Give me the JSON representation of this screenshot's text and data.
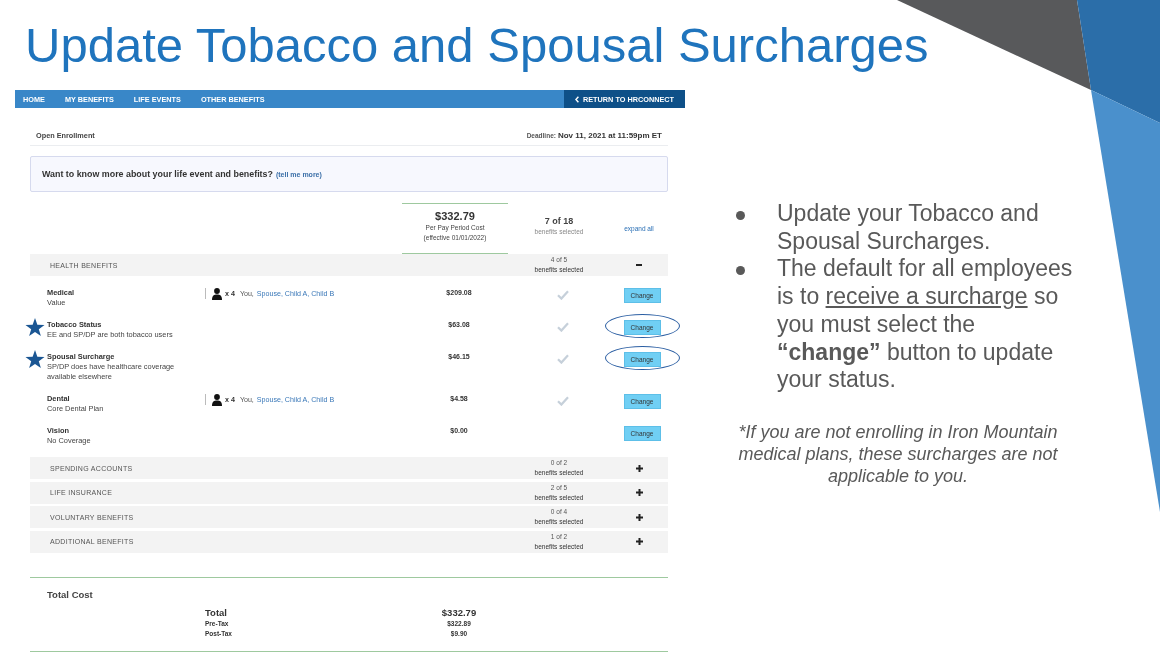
{
  "slide": {
    "title": "Update Tobacco and Spousal Surcharges"
  },
  "portal": {
    "nav": {
      "items": [
        "HOME",
        "MY BENEFITS",
        "LIFE EVENTS",
        "OTHER BENEFITS"
      ],
      "return_link": "RETURN TO HRCONNECT"
    },
    "page_title": "Open Enrollment",
    "deadline": {
      "label": "Deadline:",
      "value": "Nov 11, 2021 at 11:59pm ET"
    },
    "info_banner": {
      "text": "Want to know more about your life event and benefits?",
      "link": "(tell me more)"
    },
    "summary": {
      "cost": "$332.79",
      "cost_label": "Per Pay Period Cost",
      "effective": "(effective 01/01/2022)",
      "count": "7 of 18",
      "count_label": "benefits selected",
      "expand_link": "expand all"
    },
    "sections": [
      {
        "title": "HEALTH BENEFITS",
        "count": "4 of 5",
        "count_label": "benefits selected",
        "expanded": true,
        "plans": [
          {
            "name": "Medical",
            "detail": "Value",
            "covered": {
              "count": "x 4",
              "self": "You,",
              "others": "Spouse, Child A, Child B"
            },
            "price": "$209.08",
            "checked": true,
            "button": "Change",
            "starred": false,
            "circled": false
          },
          {
            "name": "Tobacco Status",
            "detail": "EE and SP/DP are both tobacco users",
            "price": "$63.08",
            "checked": true,
            "button": "Change",
            "starred": true,
            "circled": true
          },
          {
            "name": "Spousal Surcharge",
            "detail": "SP/DP does have healthcare coverage available elsewhere",
            "price": "$46.15",
            "checked": true,
            "button": "Change",
            "starred": true,
            "circled": true
          },
          {
            "name": "Dental",
            "detail": "Core Dental Plan",
            "covered": {
              "count": "x 4",
              "self": "You,",
              "others": "Spouse, Child A, Child B"
            },
            "price": "$4.58",
            "checked": true,
            "button": "Change",
            "starred": false,
            "circled": false
          },
          {
            "name": "Vision",
            "detail": "No Coverage",
            "price": "$0.00",
            "checked": false,
            "button": "Change",
            "starred": false,
            "circled": false
          }
        ]
      },
      {
        "title": "SPENDING ACCOUNTS",
        "count": "0 of 2",
        "count_label": "benefits selected",
        "expanded": false
      },
      {
        "title": "LIFE INSURANCE",
        "count": "2 of 5",
        "count_label": "benefits selected",
        "expanded": false
      },
      {
        "title": "VOLUNTARY BENEFITS",
        "count": "0 of 4",
        "count_label": "benefits selected",
        "expanded": false
      },
      {
        "title": "ADDITIONAL BENEFITS",
        "count": "1 of 2",
        "count_label": "benefits selected",
        "expanded": false
      }
    ],
    "total": {
      "title": "Total Cost",
      "lines": [
        {
          "label": "Total",
          "amount": "$332.79",
          "kind": "grand"
        },
        {
          "label": "Pre-Tax",
          "amount": "$322.89",
          "kind": "sub"
        },
        {
          "label": "Post-Tax",
          "amount": "$9.90",
          "kind": "sub"
        }
      ]
    }
  },
  "notes": {
    "bullets": [
      {
        "segments": [
          {
            "text": "Update your Tobacco and Spousal Surcharges.",
            "kind": "plain"
          }
        ]
      },
      {
        "segments": [
          {
            "text": "The default for all employees is to ",
            "kind": "plain"
          },
          {
            "text": "receive a surcharge",
            "kind": "underlined"
          },
          {
            "text": " so you must select the ",
            "kind": "plain"
          },
          {
            "text": "“change”",
            "kind": "bold"
          },
          {
            "text": " button to update your status.",
            "kind": "plain"
          }
        ]
      }
    ],
    "footnote": "*If you are not enrolling in Iron Mountain medical plans, these surcharges are not applicable to you."
  }
}
